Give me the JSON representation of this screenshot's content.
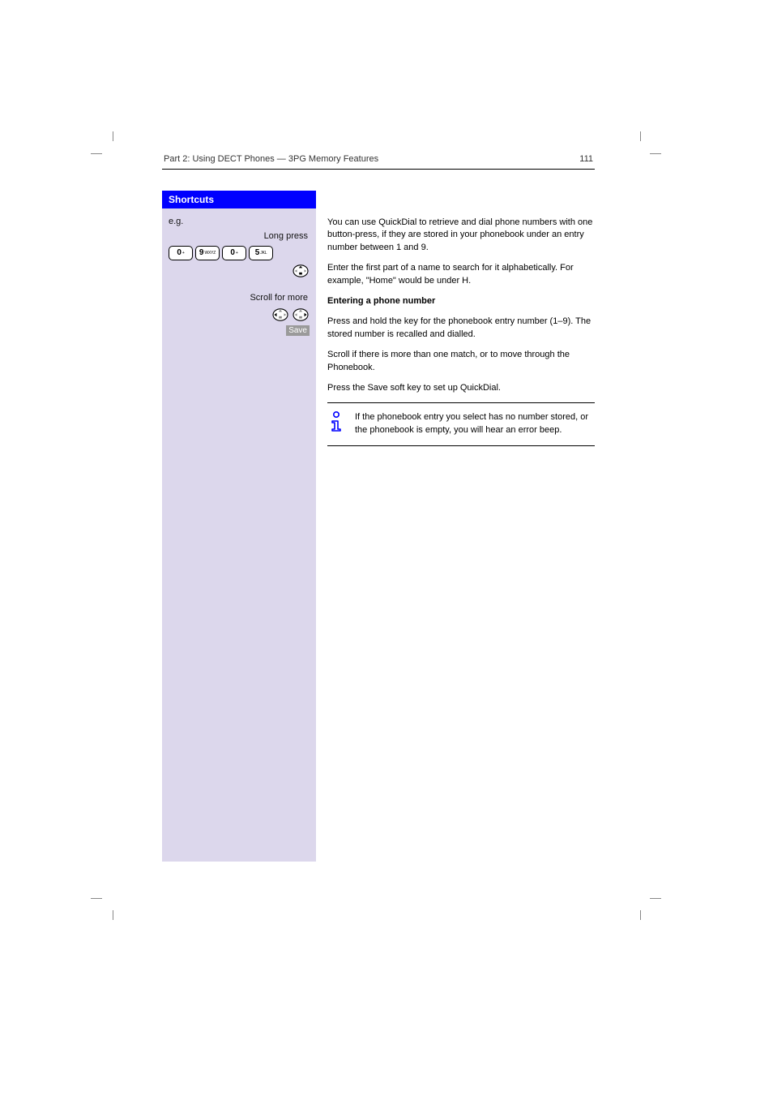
{
  "header": {
    "page_number": "111",
    "section": "Part 2: Using DECT Phones — 3PG Memory Features"
  },
  "blue_bar": "Shortcuts",
  "sidebar": {
    "step1": {
      "label": "e.g.",
      "keys": [
        {
          "main": "0",
          "sub": "+"
        },
        {
          "main": "9",
          "sub": "WXYZ"
        },
        {
          "main": "0",
          "sub": "+"
        },
        {
          "main": "5",
          "sub": "JKL"
        }
      ]
    },
    "step2": {
      "label": "Scroll for more",
      "dpad_side": "left"
    },
    "step3_label": "Save",
    "long_press_text": "Long press"
  },
  "body": {
    "intro1": "You can use QuickDial to retrieve and dial phone numbers with one button-press, if they are stored in your phonebook under an entry number between 1 and 9.",
    "intro2": "Enter the first part of a name to search for it alphabetically. For example, \"Home\" would be under H.",
    "steps_heading": "Entering a phone number",
    "step1": "Press and hold the key for the phonebook entry number (1–9). The stored number is recalled and dialled.",
    "scroll_text": "Scroll if there is more than one match, or to move through the Phonebook.",
    "save_text": "Press the Save soft key to set up QuickDial."
  },
  "note": {
    "text": "If the phonebook entry you select has no number stored, or the phonebook is empty, you will hear an error beep."
  }
}
